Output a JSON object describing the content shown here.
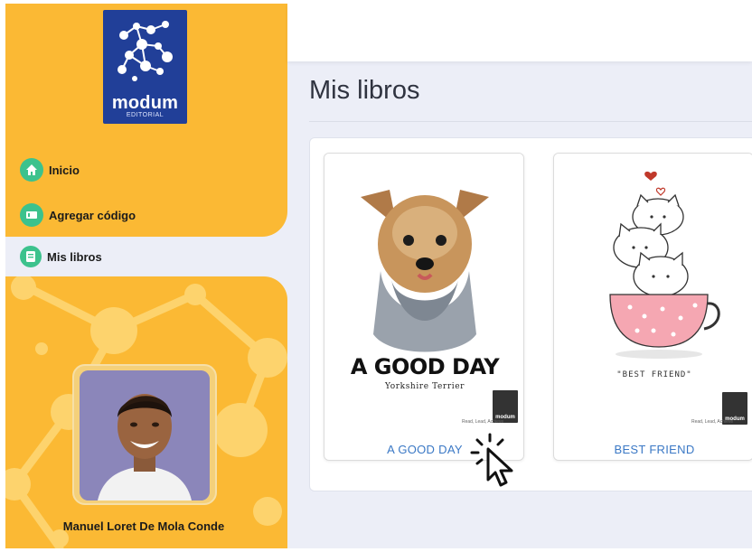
{
  "brand": {
    "name": "modum",
    "sub": "EDITORIAL"
  },
  "nav": [
    {
      "label": "Inicio",
      "icon": "home-icon"
    },
    {
      "label": "Agregar código",
      "icon": "card-icon"
    },
    {
      "label": "Mis libros",
      "icon": "book-icon",
      "active": true
    }
  ],
  "user": {
    "name": "Manuel Loret De Mola Conde"
  },
  "main": {
    "title": "Mis libros",
    "books": [
      {
        "title": "A GOOD DAY",
        "cover_title": "A GOOD DAY",
        "cover_subtitle": "Yorkshire Terrier",
        "tagline": "Read, Lead, Achieve",
        "publisher_mark": "modum"
      },
      {
        "title": "BEST FRIEND",
        "cover_title": "\"BEST FRIEND\"",
        "tagline": "Read, Lead, Achieve",
        "publisher_mark": "modum"
      }
    ]
  },
  "colors": {
    "sidebar": "#fbb934",
    "accent_green": "#3cc28d",
    "logo_blue": "#213f98",
    "link_blue": "#3a78c5",
    "background": "#eceef7"
  }
}
